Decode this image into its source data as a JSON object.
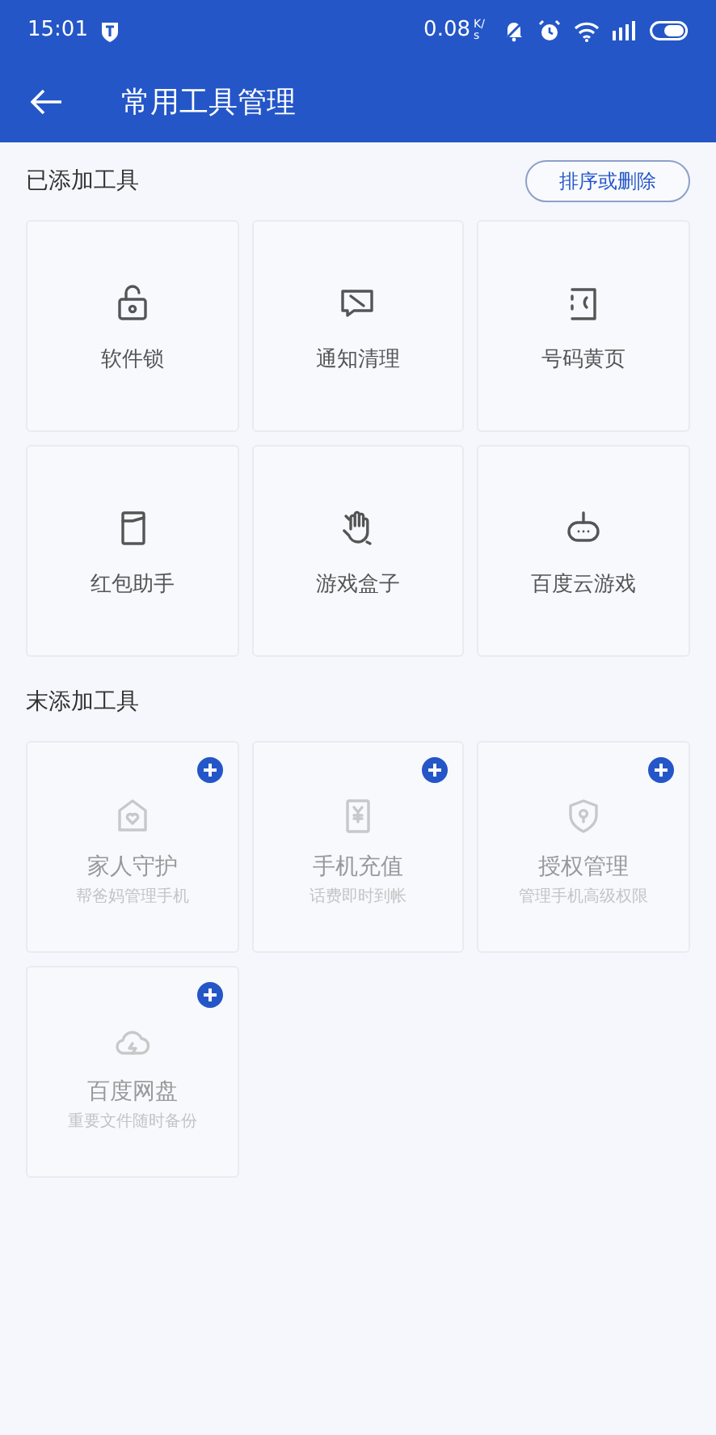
{
  "status_bar": {
    "time": "15:01",
    "speed": "0.08",
    "speed_unit": "K/s"
  },
  "app_bar": {
    "title": "常用工具管理"
  },
  "sections": [
    {
      "title": "已添加工具",
      "action": "排序或删除",
      "tools": [
        {
          "label": "软件锁",
          "added": true
        },
        {
          "label": "通知清理",
          "added": true
        },
        {
          "label": "号码黄页",
          "added": true
        },
        {
          "label": "红包助手",
          "added": true
        },
        {
          "label": "游戏盒子",
          "added": true
        },
        {
          "label": "百度云游戏",
          "added": true
        }
      ]
    },
    {
      "title": "末添加工具",
      "tools": [
        {
          "label": "家人守护",
          "subtitle": "帮爸妈管理手机",
          "added": false
        },
        {
          "label": "手机充值",
          "subtitle": "话费即时到帐",
          "added": false
        },
        {
          "label": "授权管理",
          "subtitle": "管理手机高级权限",
          "added": false
        },
        {
          "label": "百度网盘",
          "subtitle": "重要文件随时备份",
          "added": false
        }
      ]
    }
  ]
}
